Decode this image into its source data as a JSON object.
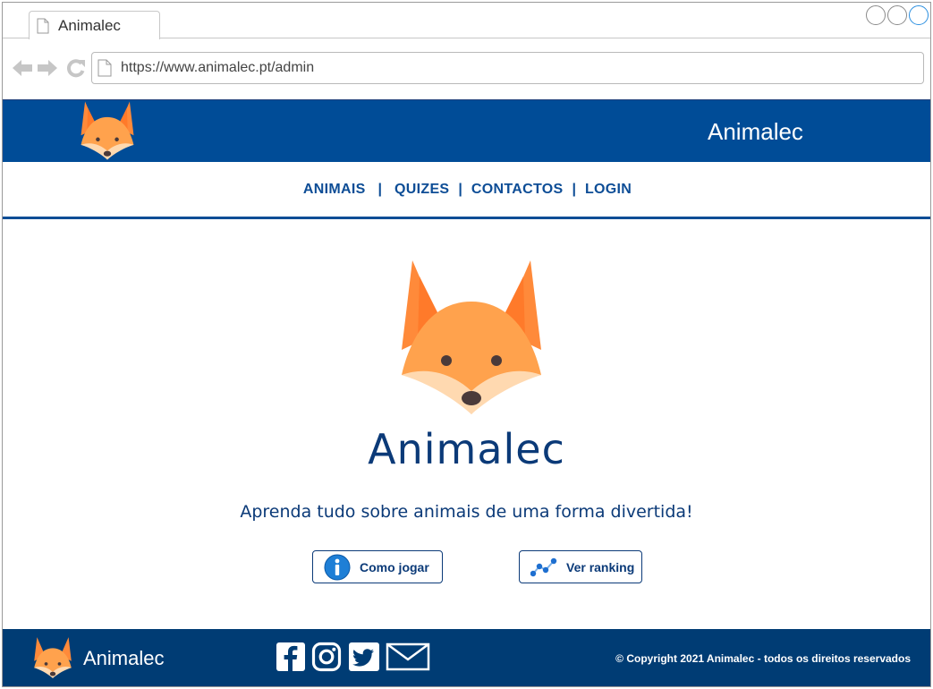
{
  "browser": {
    "tab_title": "Animalec",
    "url": "https://www.animalec.pt/admin",
    "icons": {
      "back": "arrow-left-icon",
      "forward": "arrow-right-icon",
      "reload": "reload-icon",
      "page": "document-icon"
    }
  },
  "header": {
    "brand": "Animalec",
    "logo": "fox-logo"
  },
  "menu": {
    "items": [
      {
        "label": "ANIMAIS"
      },
      {
        "label": "QUIZES"
      },
      {
        "label": "CONTACTOS"
      },
      {
        "label": "LOGIN"
      }
    ],
    "separator": "|"
  },
  "hero": {
    "title": "Animalec",
    "subtitle": "Aprenda tudo sobre animais de uma forma divertida!",
    "logo": "fox-logo"
  },
  "actions": {
    "how_to_play": {
      "label": "Como jogar",
      "icon": "info-icon"
    },
    "ranking": {
      "label": "Ver ranking",
      "icon": "ranking-icon"
    }
  },
  "footer": {
    "brand": "Animalec",
    "copyright": "© Copyright 2021 Animalec - todos os direitos reservados",
    "social": [
      "facebook-icon",
      "instagram-icon",
      "twitter-icon",
      "mail-icon"
    ]
  },
  "colors": {
    "header_blue": "#004c97",
    "footer_blue": "#003c74",
    "text_navy": "#0b3a78",
    "fox_orange": "#ffa04b"
  }
}
